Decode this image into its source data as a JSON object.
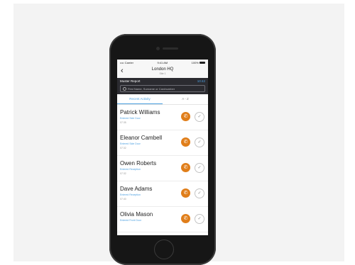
{
  "status": {
    "carrier": "•••• Carrier",
    "time": "9:41 AM",
    "battery": "100%"
  },
  "nav": {
    "back": "‹",
    "title": "London HQ",
    "subtitle": "Site 1"
  },
  "report": {
    "label": "Muster Report",
    "time": "10:42",
    "search_placeholder": "First Name, Surname or Cardnumber"
  },
  "tabs": [
    {
      "label": "Recent Activity",
      "active": true
    },
    {
      "label": "A - Z",
      "active": false
    }
  ],
  "people": [
    {
      "name": "Patrick Williams",
      "activity": "Entered Side Door",
      "time": "07:35"
    },
    {
      "name": "Eleanor Cambell",
      "activity": "Entered Side Door",
      "time": "07:32"
    },
    {
      "name": "Owen Roberts",
      "activity": "Entered Reception",
      "time": "07:32"
    },
    {
      "name": "Dave Adams",
      "activity": "Entered Reception",
      "time": "07:40"
    },
    {
      "name": "Olivia Mason",
      "activity": "Entered Front Door",
      "time": ""
    }
  ],
  "icons": {
    "call": "phone-icon",
    "check": "checkmark-icon"
  },
  "colors": {
    "accent": "#4a9fe0",
    "call": "#e07e1a",
    "header": "#2b2b30"
  }
}
